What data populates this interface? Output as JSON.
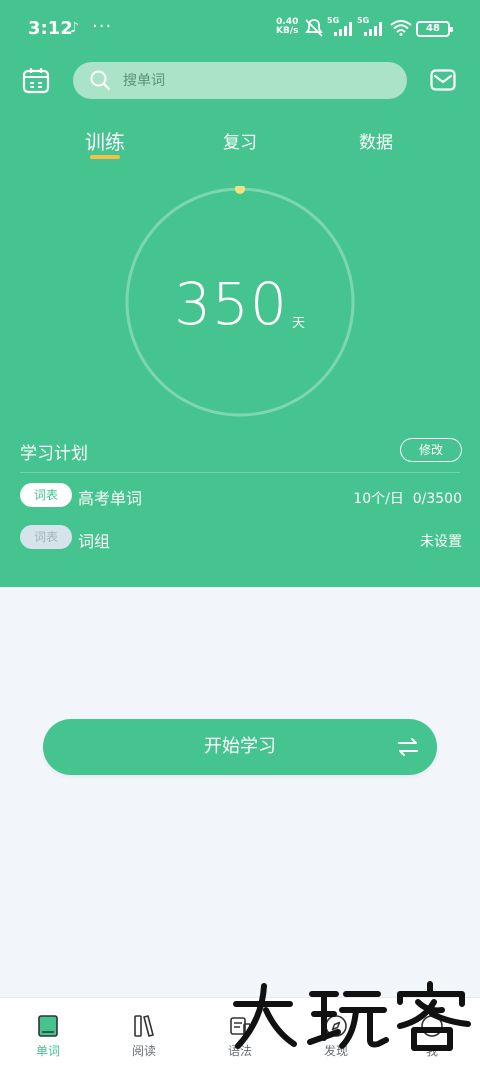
{
  "status_bar": {
    "time": "3:12",
    "speed_value": "0.40",
    "speed_unit": "KB/s",
    "signal1_label": "5G",
    "signal2_label": "5G",
    "battery": "48"
  },
  "header": {
    "search_placeholder": "搜单词"
  },
  "tabs": [
    {
      "label": "训练",
      "active": true
    },
    {
      "label": "复习",
      "active": false
    },
    {
      "label": "数据",
      "active": false
    }
  ],
  "progress": {
    "days": "350",
    "unit": "天"
  },
  "plan": {
    "title": "学习计划",
    "edit_label": "修改",
    "rows": [
      {
        "tag": "词表",
        "name": "高考单词",
        "rate": "10个/日",
        "count": "0/3500",
        "enabled": true
      },
      {
        "tag": "词表",
        "name": "词组",
        "status": "未设置",
        "enabled": false
      }
    ]
  },
  "start_button": {
    "label": "开始学习"
  },
  "bottom_nav": [
    {
      "label": "单词",
      "icon": "book-icon",
      "active": true
    },
    {
      "label": "阅读",
      "icon": "books-icon",
      "active": false
    },
    {
      "label": "语法",
      "icon": "grammar-icon",
      "active": false
    },
    {
      "label": "发现",
      "icon": "discover-icon",
      "active": false
    },
    {
      "label": "我",
      "icon": "profile-icon",
      "active": false
    }
  ],
  "watermark": "大玩家",
  "colors": {
    "brand": "#45c48f",
    "accent": "#f6c04b",
    "background": "#f2f5fa"
  }
}
